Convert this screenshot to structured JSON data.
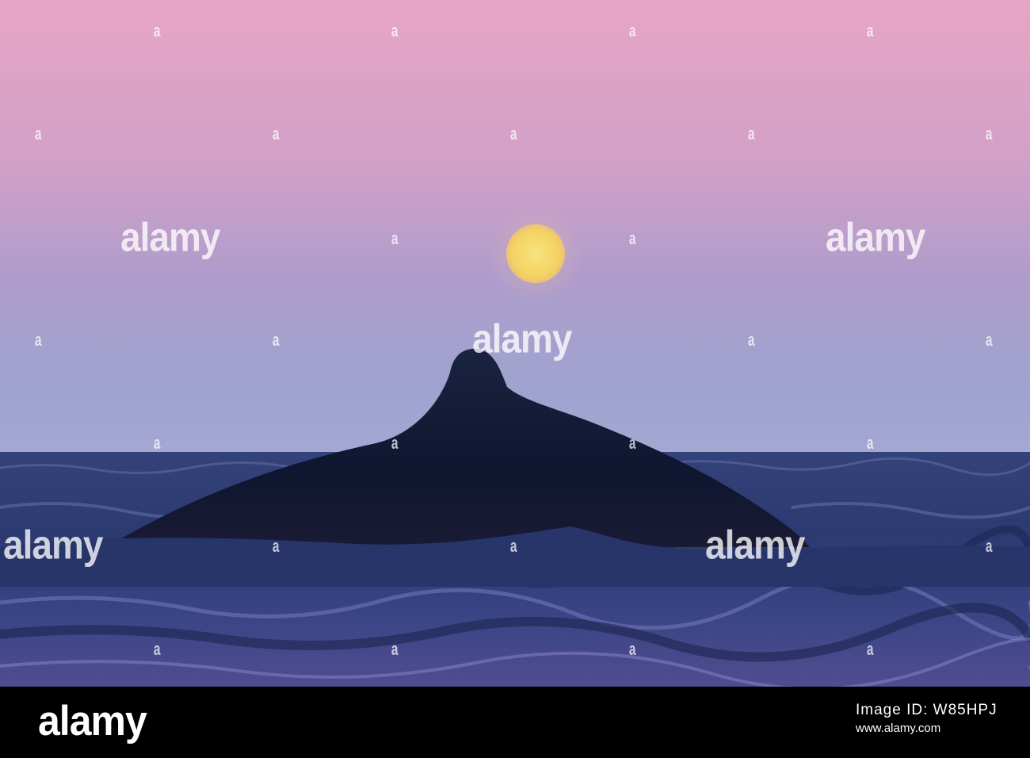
{
  "photo": {
    "subject": "whale-back-at-dusk",
    "colors": {
      "sky_top": "#e6a4c4",
      "sky_mid": "#c79bc8",
      "sky_low": "#9aa0cc",
      "sea": "#2a3a70",
      "sea_dark": "#18224a",
      "whale": "#101830",
      "moon": "#f6d86a"
    }
  },
  "watermark": {
    "text": "alamy",
    "small": "a"
  },
  "footer": {
    "logo": "alamy",
    "line1": "Image ID: W85HPJ",
    "line2": "www.alamy.com"
  }
}
